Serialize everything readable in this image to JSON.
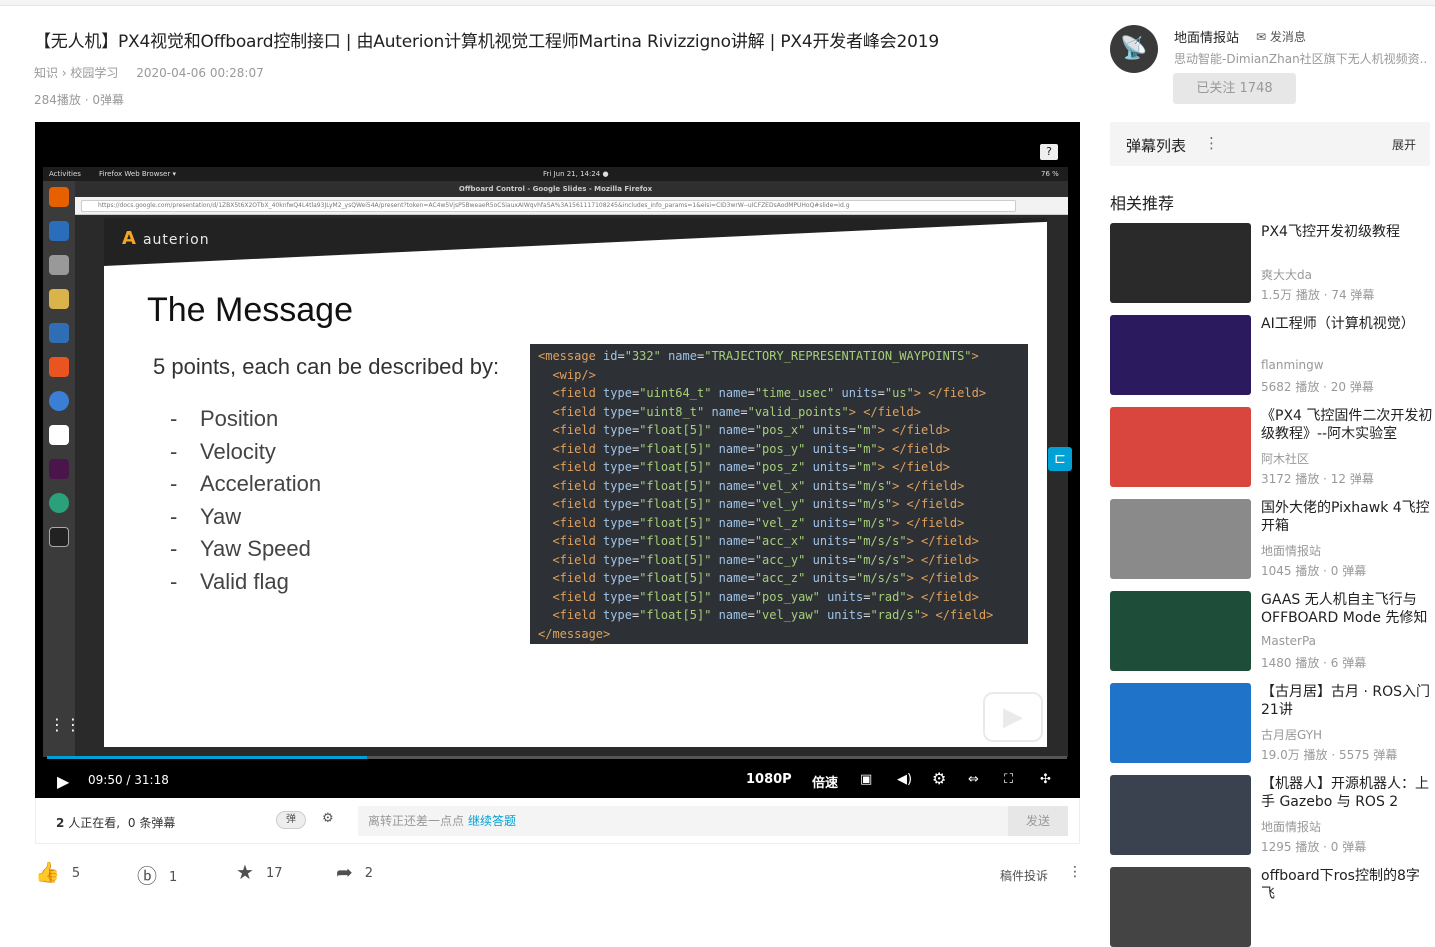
{
  "video": {
    "title": "【无人机】PX4视觉和Offboard控制接口 | 由Auterion计算机视觉工程师Martina Rivizzigno讲解 | PX4开发者峰会2019",
    "breadcrumb": "知识 › 校园学习",
    "date": "2020-04-06 00:28:07",
    "stats": "284播放 · 0弹幕"
  },
  "desktop": {
    "activities": "Activities",
    "browser_menu": "Firefox Web Browser ▾",
    "clock": "Fri Jun 21, 14:24 ●",
    "battery": "76 %",
    "window_title": "Offboard Control - Google Slides - Mozilla Firefox",
    "url": "https://docs.google.com/presentation/d/1ZBX5t6X2OTbX_40knfwQ4L4tla93JLyM2_ysQWei54A/present?token=AC4w5VjsP5BweaeR5oCSiauxAIWqvhfaSA%3A1561117108245&includes_info_params=1&eisi=CID3wrW--uICFZEDsAodMPUHoQ#slide=id.g"
  },
  "slide": {
    "logo": "auterion",
    "heading": "The Message",
    "subtitle": "5 points, each can be described by:",
    "bullets": [
      "Position",
      "Velocity",
      "Acceleration",
      "Yaw",
      "Yaw Speed",
      "Valid flag"
    ]
  },
  "code_lines": [
    {
      "indent": "",
      "tag": "<message",
      "rest": [
        [
          "id",
          "\"332\""
        ],
        [
          "name",
          "\"TRAJECTORY_REPRESENTATION_WAYPOINTS\""
        ]
      ],
      "end": ">"
    },
    {
      "indent": "  ",
      "tag": "<wip/>",
      "rest": [],
      "end": ""
    },
    {
      "indent": "  ",
      "tag": "<field",
      "rest": [
        [
          "type",
          "\"uint64_t\""
        ],
        [
          "name",
          "\"time_usec\""
        ],
        [
          "units",
          "\"us\""
        ]
      ],
      "end": "> </field>"
    },
    {
      "indent": "  ",
      "tag": "<field",
      "rest": [
        [
          "type",
          "\"uint8_t\""
        ],
        [
          "name",
          "\"valid_points\""
        ]
      ],
      "end": "> </field>"
    },
    {
      "indent": "  ",
      "tag": "<field",
      "rest": [
        [
          "type",
          "\"float[5]\""
        ],
        [
          "name",
          "\"pos_x\""
        ],
        [
          "units",
          "\"m\""
        ]
      ],
      "end": "> </field>"
    },
    {
      "indent": "  ",
      "tag": "<field",
      "rest": [
        [
          "type",
          "\"float[5]\""
        ],
        [
          "name",
          "\"pos_y\""
        ],
        [
          "units",
          "\"m\""
        ]
      ],
      "end": "> </field>"
    },
    {
      "indent": "  ",
      "tag": "<field",
      "rest": [
        [
          "type",
          "\"float[5]\""
        ],
        [
          "name",
          "\"pos_z\""
        ],
        [
          "units",
          "\"m\""
        ]
      ],
      "end": "> </field>"
    },
    {
      "indent": "  ",
      "tag": "<field",
      "rest": [
        [
          "type",
          "\"float[5]\""
        ],
        [
          "name",
          "\"vel_x\""
        ],
        [
          "units",
          "\"m/s\""
        ]
      ],
      "end": "> </field>"
    },
    {
      "indent": "  ",
      "tag": "<field",
      "rest": [
        [
          "type",
          "\"float[5]\""
        ],
        [
          "name",
          "\"vel_y\""
        ],
        [
          "units",
          "\"m/s\""
        ]
      ],
      "end": "> </field>"
    },
    {
      "indent": "  ",
      "tag": "<field",
      "rest": [
        [
          "type",
          "\"float[5]\""
        ],
        [
          "name",
          "\"vel_z\""
        ],
        [
          "units",
          "\"m/s\""
        ]
      ],
      "end": "> </field>"
    },
    {
      "indent": "  ",
      "tag": "<field",
      "rest": [
        [
          "type",
          "\"float[5]\""
        ],
        [
          "name",
          "\"acc_x\""
        ],
        [
          "units",
          "\"m/s/s\""
        ]
      ],
      "end": "> </field>"
    },
    {
      "indent": "  ",
      "tag": "<field",
      "rest": [
        [
          "type",
          "\"float[5]\""
        ],
        [
          "name",
          "\"acc_y\""
        ],
        [
          "units",
          "\"m/s/s\""
        ]
      ],
      "end": "> </field>"
    },
    {
      "indent": "  ",
      "tag": "<field",
      "rest": [
        [
          "type",
          "\"float[5]\""
        ],
        [
          "name",
          "\"acc_z\""
        ],
        [
          "units",
          "\"m/s/s\""
        ]
      ],
      "end": "> </field>"
    },
    {
      "indent": "  ",
      "tag": "<field",
      "rest": [
        [
          "type",
          "\"float[5]\""
        ],
        [
          "name",
          "\"pos_yaw\""
        ],
        [
          "units",
          "\"rad\""
        ]
      ],
      "end": "> </field>"
    },
    {
      "indent": "  ",
      "tag": "<field",
      "rest": [
        [
          "type",
          "\"float[5]\""
        ],
        [
          "name",
          "\"vel_yaw\""
        ],
        [
          "units",
          "\"rad/s\""
        ]
      ],
      "end": "> </field>"
    },
    {
      "indent": "",
      "tag": "</message>",
      "rest": [],
      "end": ""
    }
  ],
  "player": {
    "time": "09:50 / 31:18",
    "quality": "1080P",
    "speed": "倍速",
    "progress": 0.314
  },
  "danmaku_bar": {
    "watching_count": "2",
    "watching_text": "人正在看,",
    "danmaku_count": "0",
    "danmaku_text": "条弹幕",
    "toggle_label": "弹",
    "placeholder": "离转正还差一点点",
    "placeholder_link": "继续答题",
    "send": "发送"
  },
  "actions": {
    "like": "5",
    "coin": "1",
    "fav": "17",
    "share": "2",
    "report": "稿件投诉"
  },
  "uploader": {
    "name": "地面情报站",
    "message": "发消息",
    "desc": "思动智能-DimianZhan社区旗下无人机视频资...",
    "follow": "已关注 1748"
  },
  "danmaku_list": {
    "label": "弹幕列表",
    "expand": "展开"
  },
  "related_title": "相关推荐",
  "related": [
    {
      "title": "PX4飞控开发初级教程",
      "up": "爽大大da",
      "stats": "1.5万 播放 · 74 弹幕",
      "color": "#2a2a2a"
    },
    {
      "title": "AI工程师（计算机视觉）",
      "up": "flanmingw",
      "stats": "5682 播放 · 20 弹幕",
      "color": "#2b1a5e"
    },
    {
      "title": "《PX4 飞控固件二次开发初级教程》--阿木实验室",
      "up": "阿木社区",
      "stats": "3172 播放 · 12 弹幕",
      "color": "#d8463d"
    },
    {
      "title": "国外大佬的Pixhawk 4飞控开箱",
      "up": "地面情报站",
      "stats": "1045 播放 · 0 弹幕",
      "color": "#8a8a8a"
    },
    {
      "title": "GAAS 无人机自主飞行与 OFFBOARD Mode 先修知识",
      "up": "MasterPa",
      "stats": "1480 播放 · 6 弹幕",
      "color": "#1e4d3a"
    },
    {
      "title": "【古月居】古月 · ROS入门21讲",
      "up": "古月居GYH",
      "stats": "19.0万 播放 · 5575 弹幕",
      "color": "#1f74c9"
    },
    {
      "title": "【机器人】开源机器人：上手 Gazebo 与 ROS 2",
      "up": "地面情报站",
      "stats": "1295 播放 · 0 弹幕",
      "color": "#3a4250"
    },
    {
      "title": "offboard下ros控制的8字飞",
      "up": "",
      "stats": "",
      "color": "#444"
    }
  ]
}
